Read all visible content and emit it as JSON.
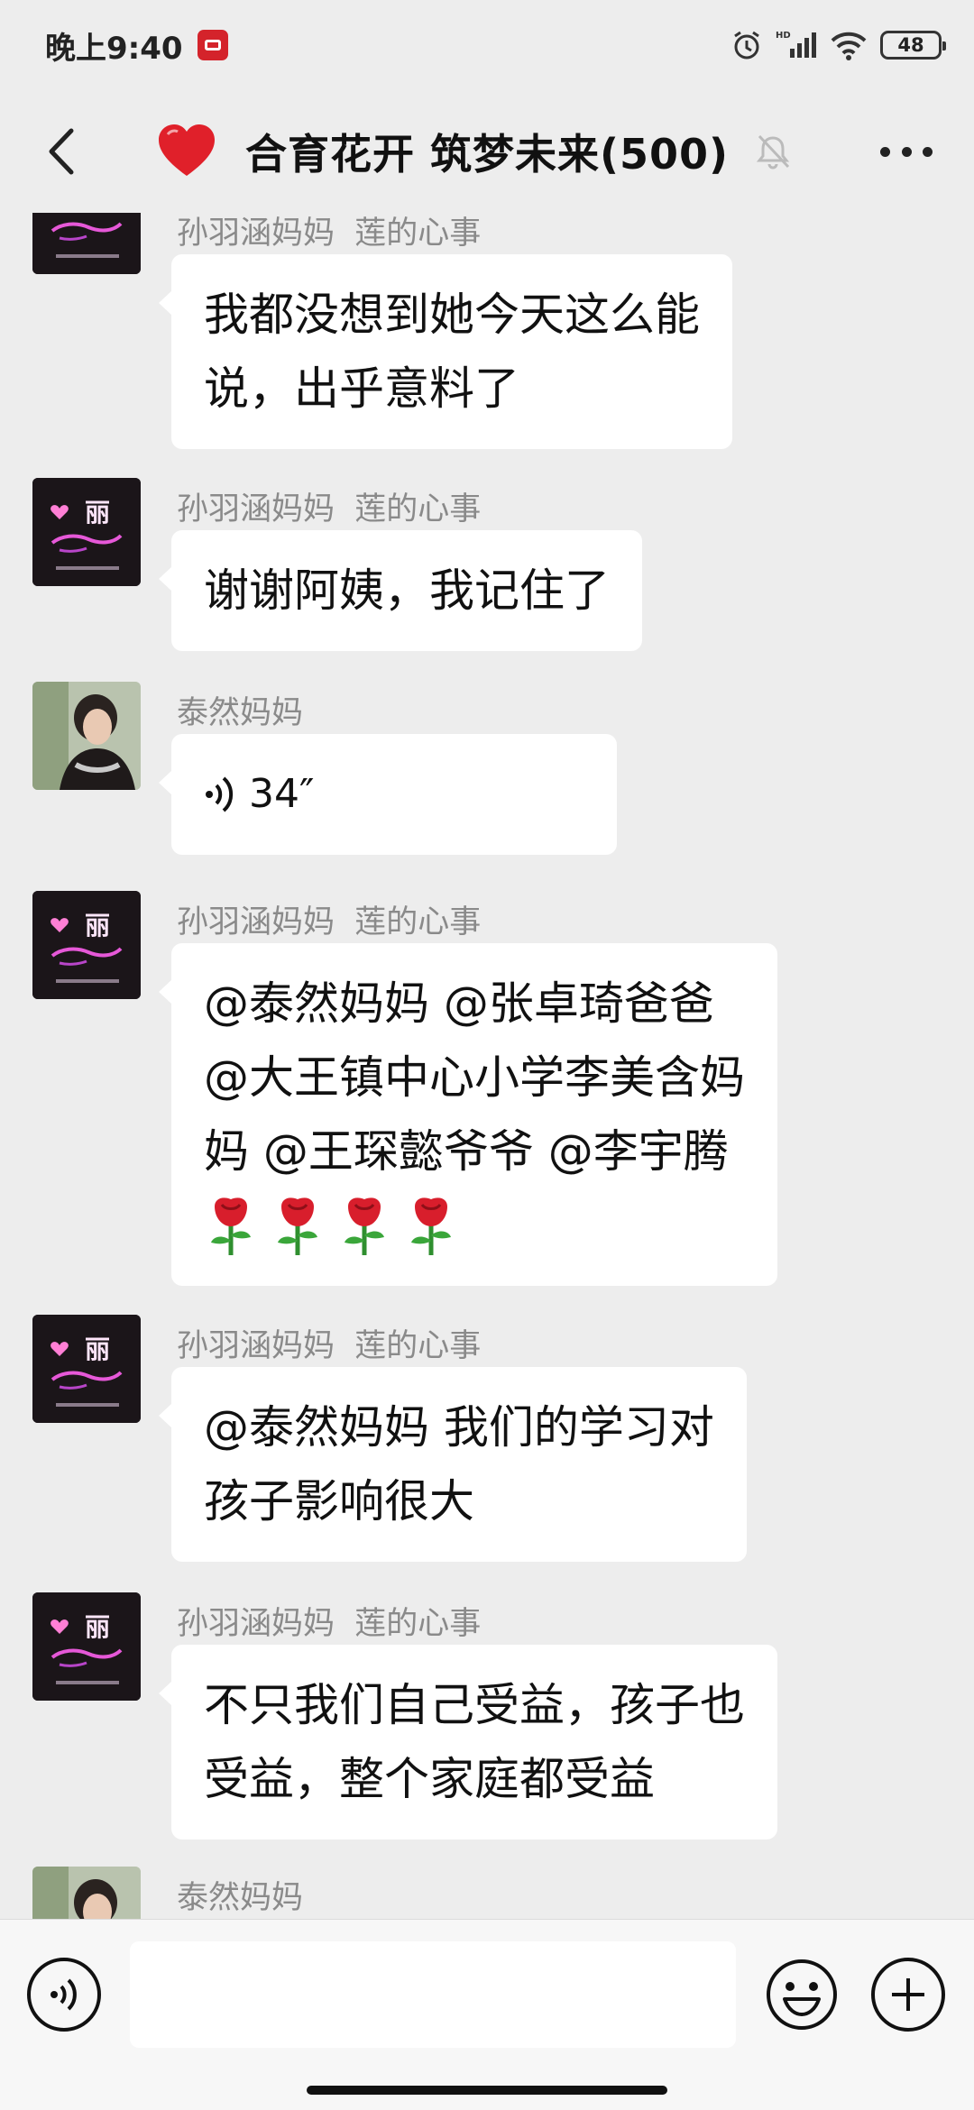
{
  "status": {
    "time": "晚上9:40",
    "battery": "48",
    "network": "HD"
  },
  "header": {
    "title": "合育花开 筑梦未来(500)"
  },
  "messages": [
    {
      "sender": "孙羽涵妈妈  莲的心事",
      "avatar": "neon-avatar",
      "lines": [
        "我都没想到她今天这么能",
        "说，出乎意料了"
      ]
    },
    {
      "sender": "孙羽涵妈妈  莲的心事",
      "avatar": "neon-avatar",
      "lines": [
        "谢谢阿姨，我记住了"
      ]
    },
    {
      "sender": "泰然妈妈",
      "avatar": "photo-avatar",
      "voice": "34″"
    },
    {
      "sender": "孙羽涵妈妈  莲的心事",
      "avatar": "neon-avatar",
      "lines": [
        "@泰然妈妈  @张卓琦爸爸",
        "@大王镇中心小学李美含妈",
        "妈  @王琛懿爷爷  @李宇腾"
      ],
      "roses": 4
    },
    {
      "sender": "孙羽涵妈妈  莲的心事",
      "avatar": "neon-avatar",
      "lines": [
        "@泰然妈妈   我们的学习对",
        "孩子影响很大"
      ]
    },
    {
      "sender": "孙羽涵妈妈  莲的心事",
      "avatar": "neon-avatar",
      "lines": [
        "不只我们自己受益，孩子也",
        "受益，整个家庭都受益"
      ]
    },
    {
      "sender": "泰然妈妈",
      "avatar": "photo-avatar"
    }
  ],
  "input": {
    "placeholder": ""
  },
  "icons": {
    "back": "chevron-left-icon",
    "heart": "heart-icon",
    "mute": "bell-muted-icon",
    "more": "more-dots-icon",
    "voice_input": "voice-icon",
    "emoji": "emoji-icon",
    "plus": "plus-icon"
  },
  "colors": {
    "background": "#ededed",
    "bubble": "#ffffff",
    "sender_text": "#8a8a8a",
    "heart": "#e0202a"
  }
}
